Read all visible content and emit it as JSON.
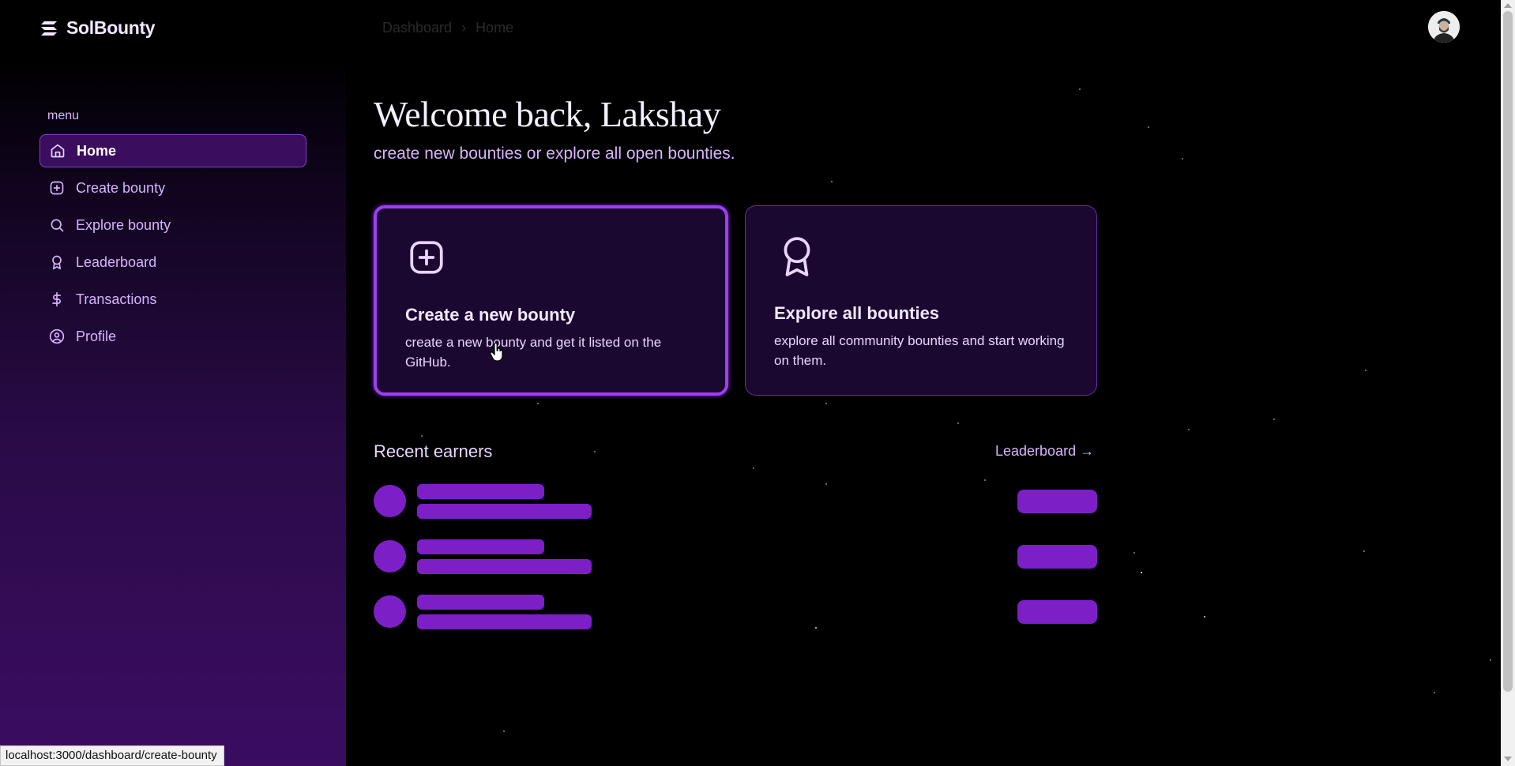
{
  "brand": {
    "name": "SolBounty",
    "logo_icon": "stack-logo-icon"
  },
  "breadcrumb": {
    "items": [
      "Dashboard",
      "Home"
    ],
    "separator": "›"
  },
  "header": {
    "avatar_icon": "user-avatar"
  },
  "sidebar": {
    "menu_label": "menu",
    "items": [
      {
        "label": "Home",
        "icon": "home-icon",
        "active": true
      },
      {
        "label": "Create bounty",
        "icon": "plus-square-icon",
        "active": false
      },
      {
        "label": "Explore bounty",
        "icon": "search-icon",
        "active": false
      },
      {
        "label": "Leaderboard",
        "icon": "award-icon",
        "active": false
      },
      {
        "label": "Transactions",
        "icon": "dollar-icon",
        "active": false
      },
      {
        "label": "Profile",
        "icon": "user-circle-icon",
        "active": false
      }
    ]
  },
  "main": {
    "welcome": "Welcome back, Lakshay",
    "subtitle": "create new bounties or explore all open bounties.",
    "cards": [
      {
        "title": "Create a new bounty",
        "description": "create a new bounty and get it listed on the GitHub.",
        "icon": "plus-square-icon"
      },
      {
        "title": "Explore all bounties",
        "description": "explore all community bounties and start working on them.",
        "icon": "award-icon"
      }
    ],
    "recent_earners": {
      "title": "Recent earners",
      "link_label": "Leaderboard →",
      "loading_rows": 3
    }
  },
  "status_bar": {
    "url": "localhost:3000/dashboard/create-bounty"
  },
  "colors": {
    "accent": "#9d3ff0",
    "skeleton": "#7c1fc7",
    "card_bg": "#1b0830",
    "text": "#e9d5ff"
  }
}
